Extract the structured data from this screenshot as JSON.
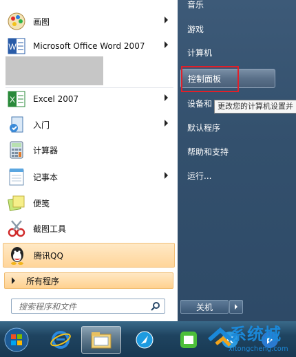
{
  "left_menu": {
    "items": [
      {
        "label": "画图",
        "has_arrow": true,
        "icon": "paint-icon"
      },
      {
        "label": "Microsoft Office Word 2007",
        "has_arrow": true,
        "icon": "word-icon"
      },
      {
        "label": "Excel 2007",
        "has_arrow": true,
        "icon": "excel-icon"
      },
      {
        "label": "入门",
        "has_arrow": true,
        "icon": "getting-started-icon"
      },
      {
        "label": "计算器",
        "has_arrow": false,
        "icon": "calculator-icon"
      },
      {
        "label": "记事本",
        "has_arrow": true,
        "icon": "notepad-icon"
      },
      {
        "label": "便笺",
        "has_arrow": false,
        "icon": "sticky-notes-icon"
      },
      {
        "label": "截图工具",
        "has_arrow": false,
        "icon": "snipping-tool-icon"
      },
      {
        "label": "腾讯QQ",
        "has_arrow": false,
        "icon": "qq-icon"
      }
    ],
    "all_programs": "所有程序",
    "search_placeholder": "搜索程序和文件"
  },
  "right_menu": {
    "items": [
      {
        "label": "音乐"
      },
      {
        "label": "游戏"
      },
      {
        "label": "计算机"
      },
      {
        "label": "控制面板",
        "selected": true
      },
      {
        "label": "设备和"
      },
      {
        "label": "默认程序"
      },
      {
        "label": "帮助和支持"
      },
      {
        "label": "运行..."
      }
    ],
    "tooltip": "更改您的计算机设置并",
    "shutdown_label": "关机"
  },
  "taskbar": {
    "items": [
      "start-orb-icon",
      "ie-icon",
      "explorer-icon",
      "app-icon",
      "iqiyi-icon",
      "kuwo-icon",
      "app-icon-2"
    ]
  },
  "watermark": {
    "text": "系统城",
    "url": "xitongcheng.com"
  },
  "colors": {
    "highlight_red": "#e0202a",
    "qq_highlight": "#ffd59a",
    "right_pane": "#33506d"
  }
}
